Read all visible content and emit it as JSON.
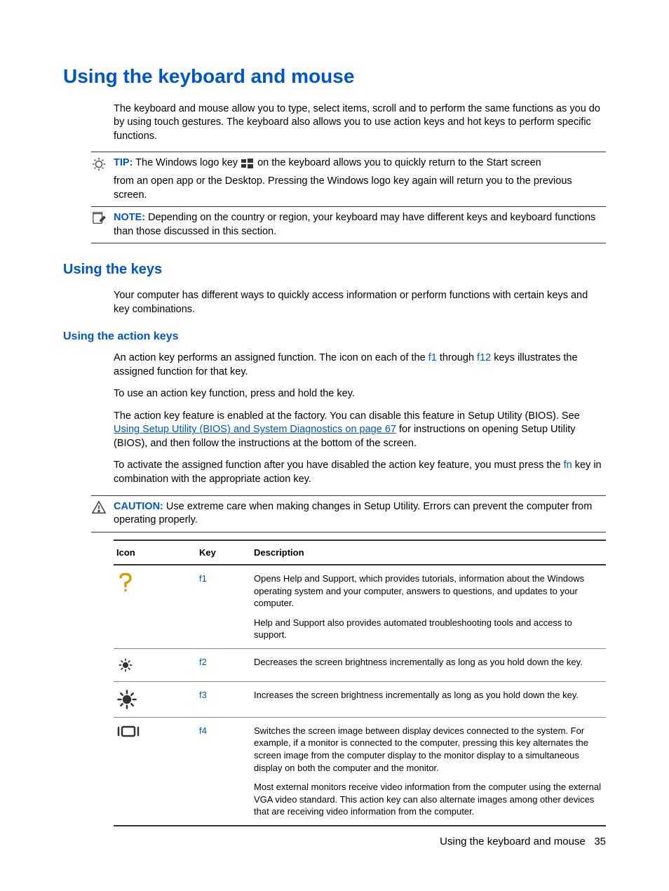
{
  "title": "Using the keyboard and mouse",
  "intro": "The keyboard and mouse allow you to type, select items, scroll and to perform the same functions as you do by using touch gestures. The keyboard also allows you to use action keys and hot keys to perform specific functions.",
  "tip": {
    "label": "TIP:",
    "pre": "The Windows logo key",
    "post": "on the keyboard allows you to quickly return to the Start screen",
    "cont": "from an open app or the Desktop. Pressing the Windows logo key again will return you to the previous screen."
  },
  "note": {
    "label": "NOTE:",
    "text": "Depending on the country or region, your keyboard may have different keys and keyboard functions than those discussed in this section."
  },
  "keys_section": {
    "title": "Using the keys",
    "text": "Your computer has different ways to quickly access information or perform functions with certain keys and key combinations."
  },
  "action_section": {
    "title": "Using the action keys",
    "p1_pre": "An action key performs an assigned function. The icon on each of the ",
    "f1": "f1",
    "p1_mid": " through ",
    "f12": "f12",
    "p1_post": " keys illustrates the assigned function for that key.",
    "p2": "To use an action key function, press and hold the key.",
    "p3_pre": "The action key feature is enabled at the factory. You can disable this feature in Setup Utility (BIOS). See ",
    "p3_link": "Using Setup Utility (BIOS) and System Diagnostics on page 67",
    "p3_post": " for instructions on opening Setup Utility (BIOS), and then follow the instructions at the bottom of the screen.",
    "p4_pre": "To activate the assigned function after you have disabled the action key feature, you must press the ",
    "fn": "fn",
    "p4_post": " key in combination with the appropriate action key."
  },
  "caution": {
    "label": "CAUTION:",
    "text": "Use extreme care when making changes in Setup Utility. Errors can prevent the computer from operating properly."
  },
  "table": {
    "headers": {
      "icon": "Icon",
      "key": "Key",
      "desc": "Description"
    },
    "rows": [
      {
        "key": "f1",
        "desc1": "Opens Help and Support, which provides tutorials, information about the Windows operating system and your computer, answers to questions, and updates to your computer.",
        "desc2": "Help and Support also provides automated troubleshooting tools and access to support."
      },
      {
        "key": "f2",
        "desc1": "Decreases the screen brightness incrementally as long as you hold down the key."
      },
      {
        "key": "f3",
        "desc1": "Increases the screen brightness incrementally as long as you hold down the key."
      },
      {
        "key": "f4",
        "desc1": "Switches the screen image between display devices connected to the system. For example, if a monitor is connected to the computer, pressing this key alternates the screen image from the computer display to the monitor display to a simultaneous display on both the computer and the monitor.",
        "desc2": "Most external monitors receive video information from the computer using the external VGA video standard. This action key can also alternate images among other devices that are receiving video information from the computer."
      }
    ]
  },
  "footer": {
    "text": "Using the keyboard and mouse",
    "page": "35"
  }
}
